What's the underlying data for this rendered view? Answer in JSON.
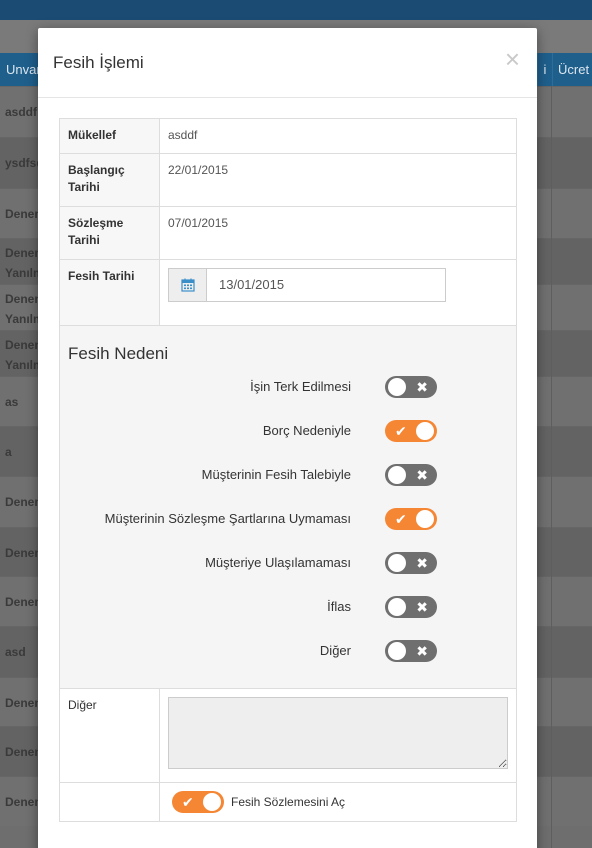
{
  "background": {
    "header_left": "Unvan",
    "header_mid": "i",
    "header_right": "Ücret",
    "rows": [
      {
        "l1": "asddf",
        "l2": ""
      },
      {
        "l1": "ysdfsd",
        "l2": ""
      },
      {
        "l1": "Denem",
        "l2": ""
      },
      {
        "l1": "Denem",
        "l2": "Yanılm"
      },
      {
        "l1": "Denem",
        "l2": "Yanılm"
      },
      {
        "l1": "Denem",
        "l2": "Yanılm"
      },
      {
        "l1": "as",
        "l2": ""
      },
      {
        "l1": "a",
        "l2": ""
      },
      {
        "l1": "Denem",
        "l2": ""
      },
      {
        "l1": "Denem",
        "l2": ""
      },
      {
        "l1": "Denem",
        "l2": ""
      },
      {
        "l1": "asd",
        "l2": ""
      },
      {
        "l1": "Denem",
        "l2": ""
      },
      {
        "l1": "Denem",
        "l2": ""
      },
      {
        "l1": "Denem",
        "l2": ""
      }
    ]
  },
  "modal": {
    "title": "Fesih İşlemi",
    "close_symbol": "×",
    "fields": {
      "mukellef_label": "Mükellef",
      "mukellef_value": "asddf",
      "baslangic_label": "Başlangıç Tarihi",
      "baslangic_value": "22/01/2015",
      "sozlesme_label": "Sözleşme Tarihi",
      "sozlesme_value": "07/01/2015",
      "fesih_label": "Fesih Tarihi",
      "fesih_value": "13/01/2015"
    },
    "reasons_title": "Fesih Nedeni",
    "reasons": [
      {
        "label": "İşin Terk Edilmesi",
        "on": false
      },
      {
        "label": "Borç Nedeniyle",
        "on": true
      },
      {
        "label": "Müşterinin Fesih Talebiyle",
        "on": false
      },
      {
        "label": "Müşterinin Sözleşme Şartlarına Uymaması",
        "on": true
      },
      {
        "label": "Müşteriye Ulaşılamaması",
        "on": false
      },
      {
        "label": "İflas",
        "on": false
      },
      {
        "label": "Diğer",
        "on": false
      }
    ],
    "other_label": "Diğer",
    "other_value": "",
    "open_contract_label": "Fesih Sözlemesini Aç",
    "open_contract_on": true
  },
  "colors": {
    "toggle_on": "#f58634",
    "toggle_off": "#6f6f6f",
    "header_blue": "#1f5f8c"
  },
  "icons": {
    "calendar": "calendar-icon",
    "check": "check-icon",
    "cross": "x-icon"
  }
}
